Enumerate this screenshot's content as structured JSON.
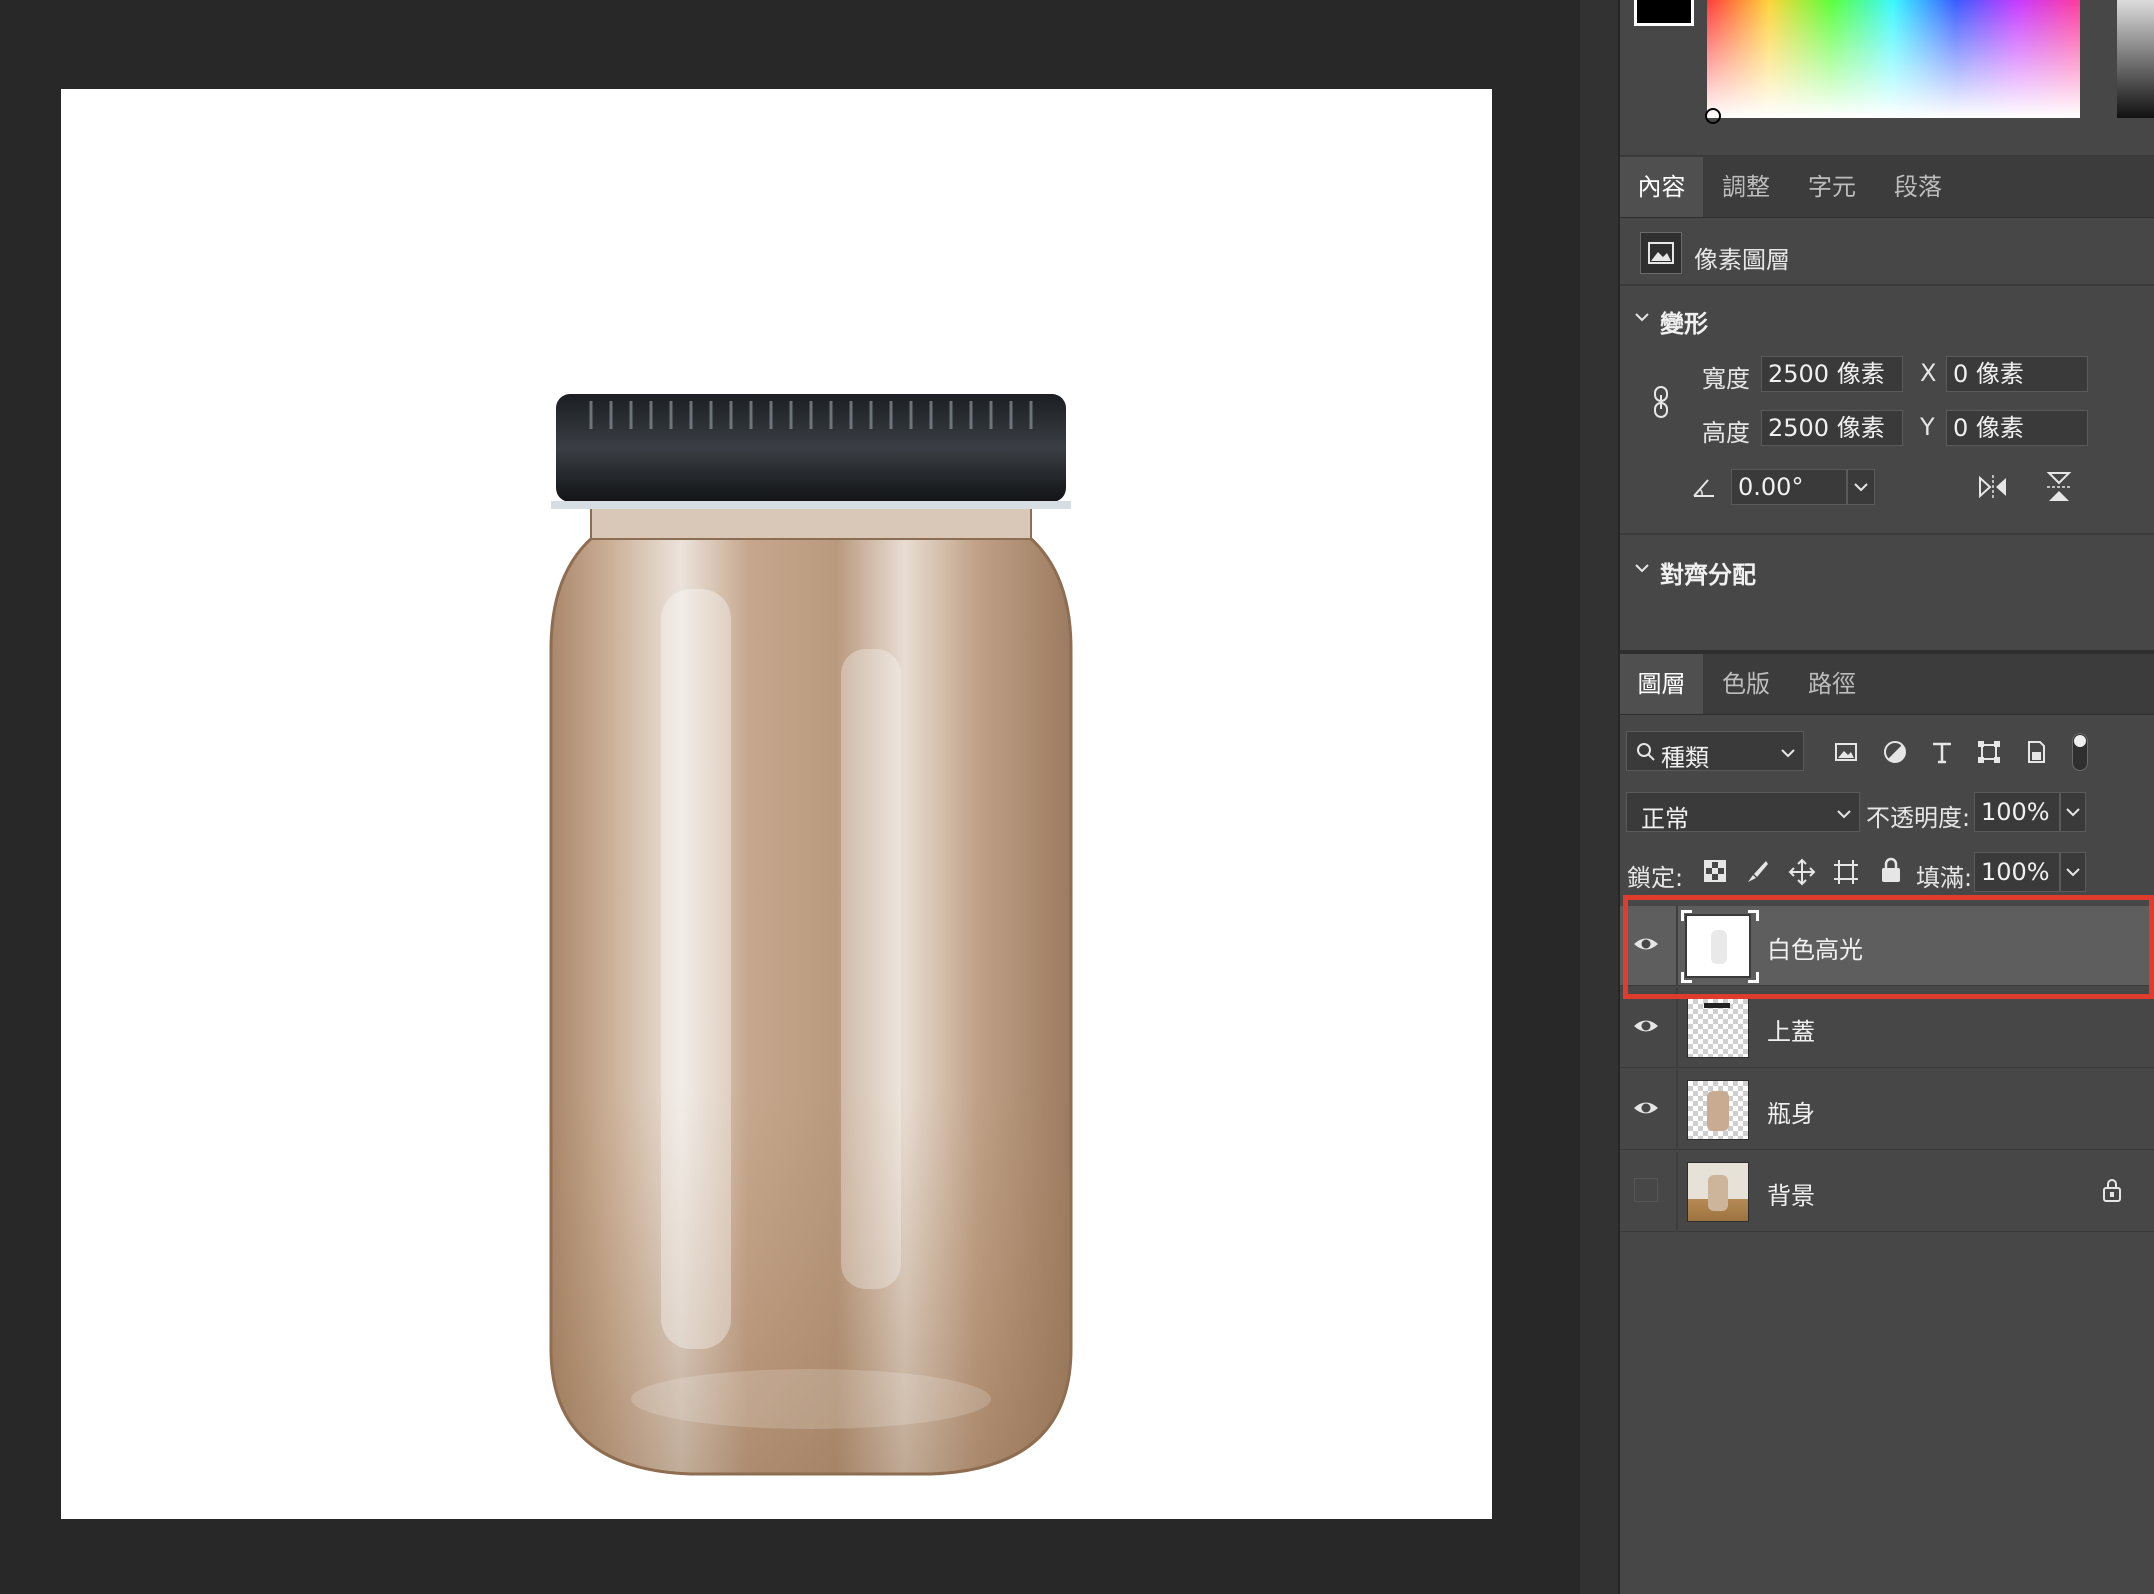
{
  "properties_tabs": [
    "內容",
    "調整",
    "字元",
    "段落"
  ],
  "layer_kind": "像素圖層",
  "transform": {
    "title": "變形",
    "width_label": "寬度",
    "width_value": "2500 像素",
    "height_label": "高度",
    "height_value": "2500 像素",
    "x_label": "X",
    "x_value": "0 像素",
    "y_label": "Y",
    "y_value": "0 像素",
    "angle_value": "0.00°"
  },
  "align": {
    "title": "對齊分配"
  },
  "layers_tabs": [
    "圖層",
    "色版",
    "路徑"
  ],
  "filter": {
    "label": "種類"
  },
  "blend": {
    "mode": "正常",
    "opacity_label": "不透明度:",
    "opacity_value": "100%",
    "lock_label": "鎖定:",
    "fill_label": "填滿:",
    "fill_value": "100%"
  },
  "layers": [
    {
      "name": "白色高光",
      "visible": true,
      "selected": true
    },
    {
      "name": "上蓋",
      "visible": true,
      "selected": false
    },
    {
      "name": "瓶身",
      "visible": true,
      "selected": false
    },
    {
      "name": "背景",
      "visible": false,
      "selected": false,
      "locked": true
    }
  ],
  "colors": {
    "panel_bg": "#474747",
    "workspace_bg": "#282828",
    "selection_outline": "#e03c2d",
    "selected_row": "#5e5e5e"
  }
}
